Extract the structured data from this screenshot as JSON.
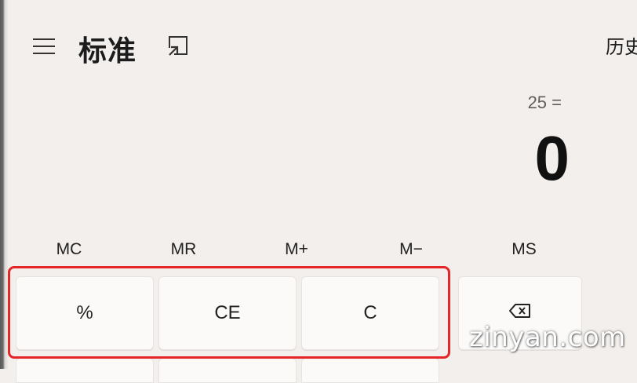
{
  "header": {
    "mode_title": "标准",
    "history_label": "历史"
  },
  "display": {
    "expression": "25 =",
    "result": "0"
  },
  "memory_row": {
    "mc": "MC",
    "mr": "MR",
    "m_plus": "M+",
    "m_minus": "M−",
    "ms": "MS"
  },
  "keys": {
    "percent": "%",
    "clear_entry": "CE",
    "clear": "C"
  },
  "icons": {
    "menu": "hamburger-menu-icon",
    "keep_on_top": "keep-on-top-icon",
    "backspace": "backspace-icon"
  },
  "colors": {
    "highlight": "#e4252a",
    "background": "#f3efec"
  },
  "watermark": "zinyan.com"
}
